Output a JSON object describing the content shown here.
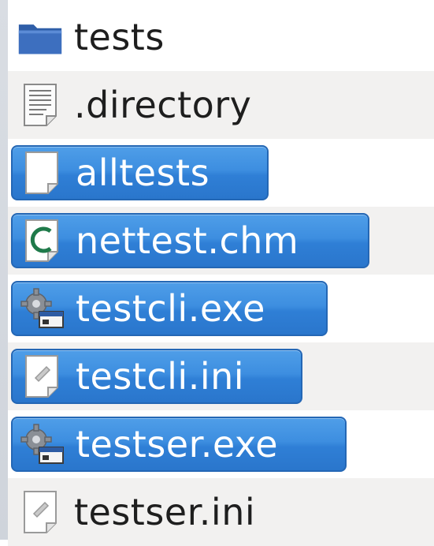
{
  "files": [
    {
      "name": "tests",
      "icon": "folder-icon",
      "selected": false
    },
    {
      "name": ".directory",
      "icon": "text-file-icon",
      "selected": false
    },
    {
      "name": "alltests",
      "icon": "blank-file-icon",
      "selected": true
    },
    {
      "name": "nettest.chm",
      "icon": "chm-help-file-icon",
      "selected": true
    },
    {
      "name": "testcli.exe",
      "icon": "executable-gear-icon",
      "selected": true
    },
    {
      "name": "testcli.ini",
      "icon": "config-file-icon",
      "selected": true
    },
    {
      "name": "testser.exe",
      "icon": "executable-gear-icon",
      "selected": true
    },
    {
      "name": "testser.ini",
      "icon": "config-file-icon",
      "selected": false
    }
  ],
  "colors": {
    "selection": "#2f7fd6",
    "selection_border": "#2467b5",
    "folder": "#3a68b5",
    "alt_row": "#f2f1f0"
  }
}
